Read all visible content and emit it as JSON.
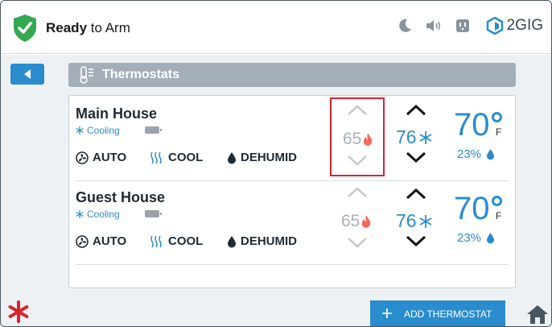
{
  "header": {
    "status_bold": "Ready",
    "status_rest": " to Arm",
    "brand": "2GIG",
    "icons": [
      "shield-check-icon",
      "moon-icon",
      "speaker-icon",
      "outlet-icon",
      "brand-logo-icon"
    ]
  },
  "page": {
    "title": "Thermostats"
  },
  "thermostats": [
    {
      "name": "Main House",
      "mode": "Cooling",
      "fan": "AUTO",
      "system": "COOL",
      "dehumid": "DEHUMID",
      "heat_setpoint": "65",
      "cool_setpoint": "76",
      "temperature": "70",
      "unit": "F",
      "humidity": "23%"
    },
    {
      "name": "Guest House",
      "mode": "Cooling",
      "fan": "AUTO",
      "system": "COOL",
      "dehumid": "DEHUMID",
      "heat_setpoint": "65",
      "cool_setpoint": "76",
      "temperature": "70",
      "unit": "F",
      "humidity": "23%"
    }
  ],
  "footer": {
    "add_label": "ADD THERMOSTAT"
  },
  "colors": {
    "accent": "#2a8ccd",
    "alert": "#d9232d",
    "shield": "#35a852",
    "heat": "#f26a5c"
  }
}
